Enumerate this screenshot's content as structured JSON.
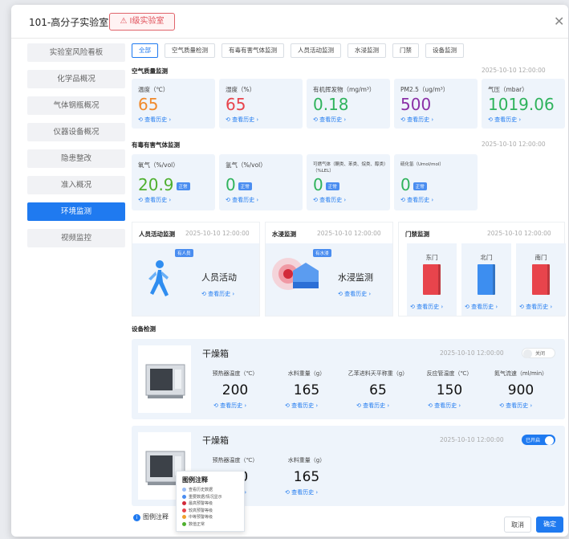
{
  "header": {
    "title": "101-高分子实验室",
    "badge": "I级实验室"
  },
  "sidebar": {
    "items": [
      "实验室风险看板",
      "化学品概况",
      "气体钢瓶概况",
      "仪器设备概况",
      "隐患整改",
      "准入概况",
      "环境监测",
      "视频监控"
    ],
    "active_index": 6
  },
  "tabs": {
    "items": [
      "全部",
      "空气质量检测",
      "有毒有害气体监测",
      "人员活动监测",
      "水浸监测",
      "门禁",
      "设备监测"
    ],
    "active_index": 0
  },
  "history_label": "查看历史",
  "air": {
    "title": "空气质量监测",
    "date": "2025-10-10   12:00:00",
    "cards": [
      {
        "label": "温度（℃）",
        "value": "65",
        "color": "#f08a2c"
      },
      {
        "label": "湿度（%）",
        "value": "65",
        "color": "#e8444c"
      },
      {
        "label": "有机挥发物（mg/m³）",
        "value": "0.18",
        "color": "#2fb35c"
      },
      {
        "label": "PM2.5（ug/m³）",
        "value": "500",
        "color": "#8a2fa6"
      },
      {
        "label": "气压（mbar）",
        "value": "1019.06",
        "color": "#2fb35c"
      }
    ]
  },
  "gas": {
    "title": "有毒有害气体监测",
    "date": "2025-10-10   12:00:00",
    "cards": [
      {
        "label": "氧气（%/vol）",
        "value": "20.9",
        "color": "#4fb02f",
        "pill": "正常"
      },
      {
        "label": "氢气（%/vol）",
        "value": "0",
        "color": "#2fb35c",
        "pill": "正常"
      },
      {
        "label": "可燃气体（酮类、苯类、烷类、醇类）（%LEL）",
        "value": "0",
        "color": "#2fb35c",
        "pill": "正常"
      },
      {
        "label": "硫化氢（Umol/mol）",
        "value": "0",
        "color": "#2fb35c",
        "pill": "正常"
      }
    ]
  },
  "person": {
    "title": "人员活动监测",
    "date": "2025-10-10   12:00:00",
    "status": "人员活动",
    "tag": "有人员"
  },
  "water": {
    "title": "水浸监测",
    "date": "2025-10-10   12:00:00",
    "status": "水浸监测",
    "tag": "有水浸"
  },
  "door": {
    "title": "门禁监测",
    "date": "2025-10-10   12:00:00",
    "doors": [
      {
        "name": "东门",
        "color": "#e8444c"
      },
      {
        "name": "北门",
        "color": "#3d8ef0"
      },
      {
        "name": "南门",
        "color": "#e8444c"
      }
    ]
  },
  "device": {
    "title": "设备检测",
    "items": [
      {
        "name": "干燥箱",
        "date": "2025-10-10   12:00:00",
        "toggle": "关闭",
        "on": false,
        "metrics": [
          {
            "label": "预热器温度（℃）",
            "value": "200"
          },
          {
            "label": "水料重量（g）",
            "value": "165"
          },
          {
            "label": "乙苯进料天平称重（g）",
            "value": "65"
          },
          {
            "label": "反应管温度（℃）",
            "value": "150"
          },
          {
            "label": "氮气流速（ml/min）",
            "value": "900"
          }
        ]
      },
      {
        "name": "干燥箱",
        "date": "2025-10-10   12:00:00",
        "toggle": "已开启",
        "on": true,
        "metrics": [
          {
            "label": "预热器温度（℃）",
            "value": "200"
          },
          {
            "label": "水料重量（g）",
            "value": "165"
          }
        ]
      }
    ]
  },
  "legend": {
    "title": "图例注释",
    "items": [
      {
        "text": "查看历史数据",
        "color": "#9bbdf5"
      },
      {
        "text": "重要数据/情况显示",
        "color": "#4a8df0"
      },
      {
        "text": "最高预警等级",
        "color": "#d22a3a"
      },
      {
        "text": "较高预警等级",
        "color": "#e8444c"
      },
      {
        "text": "中等预警等级",
        "color": "#f0a02c"
      },
      {
        "text": "数值正常",
        "color": "#4fb02f"
      }
    ]
  },
  "footer": {
    "legend_link": "图例注释",
    "cancel": "取消",
    "confirm": "确定"
  },
  "accent": "#1f7af0"
}
